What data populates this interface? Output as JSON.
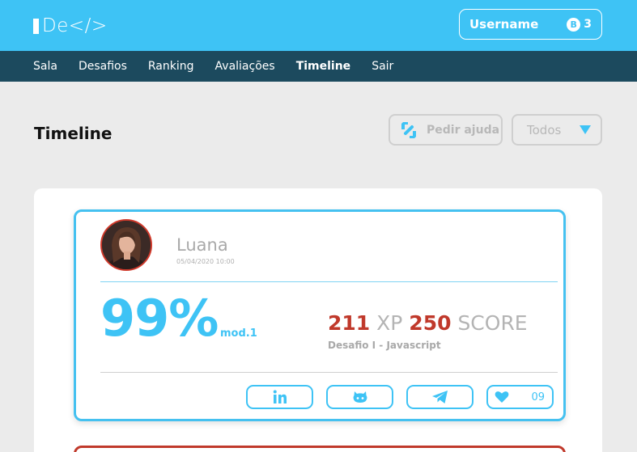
{
  "header": {
    "logo_text": "De</>",
    "username": "Username",
    "coin_symbol": "B",
    "coin_count": "3"
  },
  "nav": {
    "items": [
      {
        "label": "Sala"
      },
      {
        "label": "Desafios"
      },
      {
        "label": "Ranking"
      },
      {
        "label": "Avaliações"
      },
      {
        "label": "Timeline",
        "active": true
      },
      {
        "label": "Sair"
      }
    ]
  },
  "main": {
    "title": "Timeline",
    "help_label": "Pedir ajuda",
    "filter_value": "Todos"
  },
  "post": {
    "name": "Luana",
    "date": "05/04/2020 10:00",
    "percent": "99%",
    "module": "mod.1",
    "xp_value": "211",
    "xp_label": "XP",
    "score_value": "250",
    "score_label": "SCORE",
    "challenge": "Desafio I - Javascript",
    "likes": "09"
  },
  "colors": {
    "accent": "#3ec3f5",
    "nav_bg": "#1c4a5e",
    "highlight_red": "#c0392b"
  }
}
